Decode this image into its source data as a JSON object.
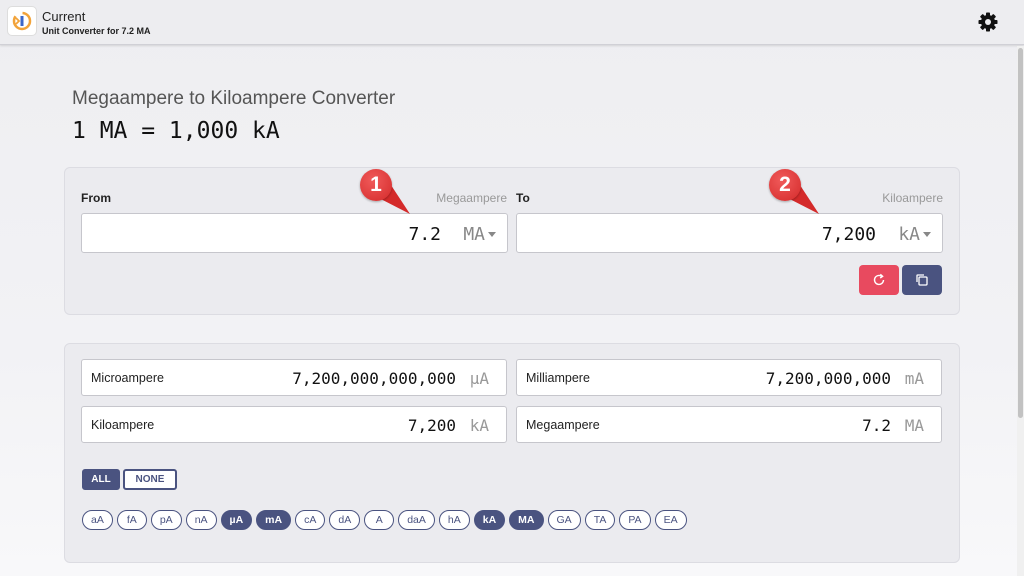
{
  "header": {
    "title": "Current",
    "subtitle": "Unit Converter for 7.2 MA",
    "logo_icon": "current-converter-logo-icon",
    "settings_icon": "gear-icon"
  },
  "page": {
    "title": "Megaampere to Kiloampere Converter",
    "formula": "1 MA = 1,000 kA"
  },
  "converter": {
    "from": {
      "label": "From",
      "unit_name": "Megaampere",
      "value": "7.2",
      "unit": "MA"
    },
    "to": {
      "label": "To",
      "unit_name": "Kiloampere",
      "value": "7,200",
      "unit": "kA"
    },
    "markers": [
      "1",
      "2"
    ],
    "colors": {
      "reset": "#e84a5f",
      "copy": "#4a5380",
      "marker": "#d42a2a"
    }
  },
  "results": [
    {
      "name": "Microampere",
      "value": "7,200,000,000,000",
      "unit": "µA"
    },
    {
      "name": "Milliampere",
      "value": "7,200,000,000",
      "unit": "mA"
    },
    {
      "name": "Kiloampere",
      "value": "7,200",
      "unit": "kA"
    },
    {
      "name": "Megaampere",
      "value": "7.2",
      "unit": "MA"
    }
  ],
  "toggles": {
    "all": "ALL",
    "none": "NONE"
  },
  "chips": [
    {
      "label": "aA",
      "selected": false
    },
    {
      "label": "fA",
      "selected": false
    },
    {
      "label": "pA",
      "selected": false
    },
    {
      "label": "nA",
      "selected": false
    },
    {
      "label": "µA",
      "selected": true
    },
    {
      "label": "mA",
      "selected": true
    },
    {
      "label": "cA",
      "selected": false
    },
    {
      "label": "dA",
      "selected": false
    },
    {
      "label": "A",
      "selected": false
    },
    {
      "label": "daA",
      "selected": false
    },
    {
      "label": "hA",
      "selected": false
    },
    {
      "label": "kA",
      "selected": true
    },
    {
      "label": "MA",
      "selected": true
    },
    {
      "label": "GA",
      "selected": false
    },
    {
      "label": "TA",
      "selected": false
    },
    {
      "label": "PA",
      "selected": false
    },
    {
      "label": "EA",
      "selected": false
    }
  ]
}
